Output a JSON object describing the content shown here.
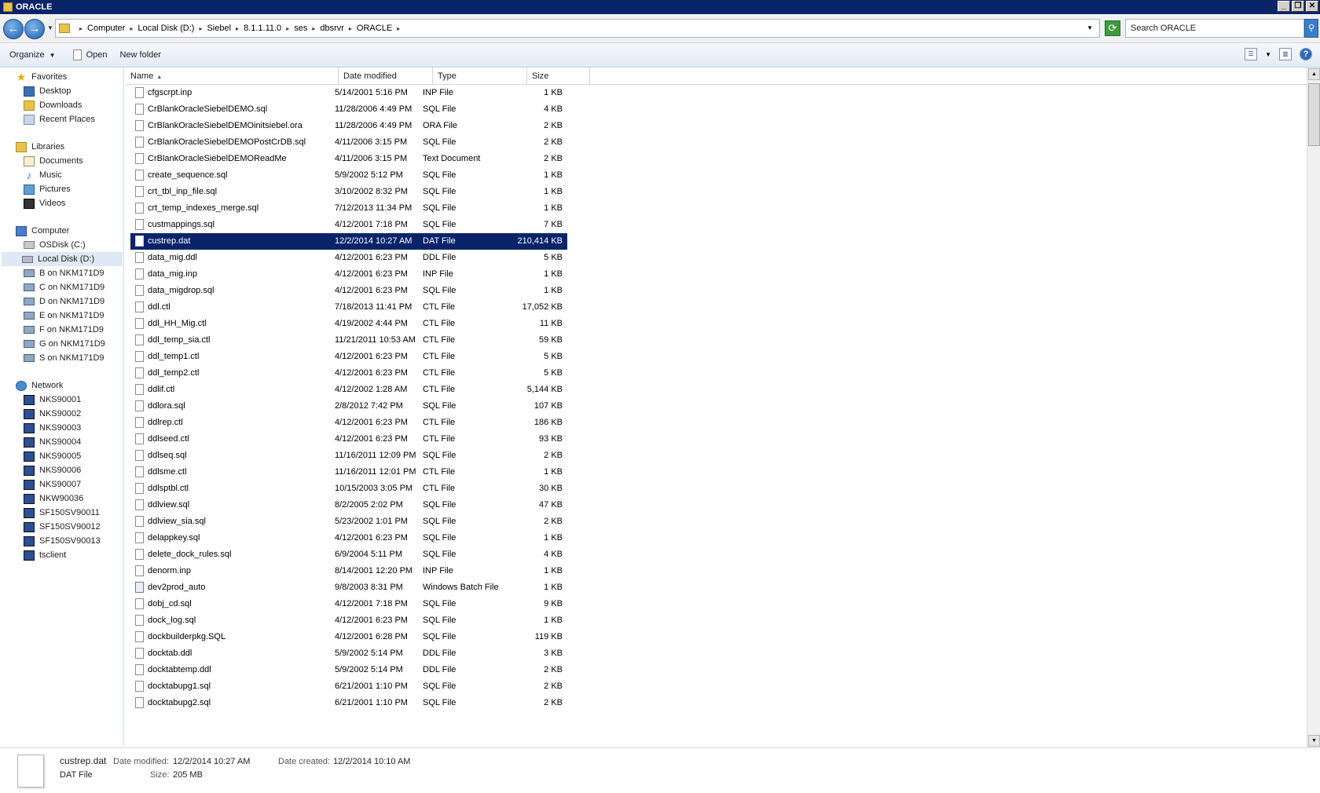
{
  "window": {
    "title": "ORACLE"
  },
  "breadcrumb": [
    "Computer",
    "Local Disk (D:)",
    "Siebel",
    "8.1.1.11.0",
    "ses",
    "dbsrvr",
    "ORACLE"
  ],
  "search": {
    "placeholder": "Search ORACLE"
  },
  "toolbar": {
    "organize": "Organize",
    "open": "Open",
    "new_folder": "New folder"
  },
  "nav": {
    "favorites": {
      "label": "Favorites",
      "items": [
        "Desktop",
        "Downloads",
        "Recent Places"
      ]
    },
    "libraries": {
      "label": "Libraries",
      "items": [
        "Documents",
        "Music",
        "Pictures",
        "Videos"
      ]
    },
    "computer": {
      "label": "Computer",
      "items": [
        "OSDisk (C:)",
        "Local Disk (D:)",
        "B on NKM171D9",
        "C on NKM171D9",
        "D on NKM171D9",
        "E on NKM171D9",
        "F on NKM171D9",
        "G on NKM171D9",
        "S on NKM171D9"
      ],
      "selected": "Local Disk (D:)"
    },
    "network": {
      "label": "Network",
      "items": [
        "NKS90001",
        "NKS90002",
        "NKS90003",
        "NKS90004",
        "NKS90005",
        "NKS90006",
        "NKS90007",
        "NKW90036",
        "SF150SV90011",
        "SF150SV90012",
        "SF150SV90013",
        "tsclient"
      ]
    }
  },
  "columns": {
    "name": "Name",
    "date": "Date modified",
    "type": "Type",
    "size": "Size"
  },
  "files": [
    {
      "name": "cfgscrpt.inp",
      "date": "5/14/2001 5:16 PM",
      "type": "INP File",
      "size": "1 KB"
    },
    {
      "name": "CrBlankOracleSiebelDEMO.sql",
      "date": "11/28/2006 4:49 PM",
      "type": "SQL File",
      "size": "4 KB"
    },
    {
      "name": "CrBlankOracleSiebelDEMOinitsiebel.ora",
      "date": "11/28/2006 4:49 PM",
      "type": "ORA File",
      "size": "2 KB"
    },
    {
      "name": "CrBlankOracleSiebelDEMOPostCrDB.sql",
      "date": "4/11/2006 3:15 PM",
      "type": "SQL File",
      "size": "2 KB"
    },
    {
      "name": "CrBlankOracleSiebelDEMOReadMe",
      "date": "4/11/2006 3:15 PM",
      "type": "Text Document",
      "size": "2 KB"
    },
    {
      "name": "create_sequence.sql",
      "date": "5/9/2002 5:12 PM",
      "type": "SQL File",
      "size": "1 KB"
    },
    {
      "name": "crt_tbl_inp_file.sql",
      "date": "3/10/2002 8:32 PM",
      "type": "SQL File",
      "size": "1 KB"
    },
    {
      "name": "crt_temp_indexes_merge.sql",
      "date": "7/12/2013 11:34 PM",
      "type": "SQL File",
      "size": "1 KB"
    },
    {
      "name": "custmappings.sql",
      "date": "4/12/2001 7:18 PM",
      "type": "SQL File",
      "size": "7 KB"
    },
    {
      "name": "custrep.dat",
      "date": "12/2/2014 10:27 AM",
      "type": "DAT File",
      "size": "210,414 KB",
      "selected": true
    },
    {
      "name": "data_mig.ddl",
      "date": "4/12/2001 6:23 PM",
      "type": "DDL File",
      "size": "5 KB"
    },
    {
      "name": "data_mig.inp",
      "date": "4/12/2001 6:23 PM",
      "type": "INP File",
      "size": "1 KB"
    },
    {
      "name": "data_migdrop.sql",
      "date": "4/12/2001 6:23 PM",
      "type": "SQL File",
      "size": "1 KB"
    },
    {
      "name": "ddl.ctl",
      "date": "7/18/2013 11:41 PM",
      "type": "CTL File",
      "size": "17,052 KB"
    },
    {
      "name": "ddl_HH_Mig.ctl",
      "date": "4/19/2002 4:44 PM",
      "type": "CTL File",
      "size": "11 KB"
    },
    {
      "name": "ddl_temp_sia.ctl",
      "date": "11/21/2011 10:53 AM",
      "type": "CTL File",
      "size": "59 KB"
    },
    {
      "name": "ddl_temp1.ctl",
      "date": "4/12/2001 6:23 PM",
      "type": "CTL File",
      "size": "5 KB"
    },
    {
      "name": "ddl_temp2.ctl",
      "date": "4/12/2001 6:23 PM",
      "type": "CTL File",
      "size": "5 KB"
    },
    {
      "name": "ddlif.ctl",
      "date": "4/12/2002 1:28 AM",
      "type": "CTL File",
      "size": "5,144 KB"
    },
    {
      "name": "ddlora.sql",
      "date": "2/8/2012 7:42 PM",
      "type": "SQL File",
      "size": "107 KB"
    },
    {
      "name": "ddlrep.ctl",
      "date": "4/12/2001 6:23 PM",
      "type": "CTL File",
      "size": "186 KB"
    },
    {
      "name": "ddlseed.ctl",
      "date": "4/12/2001 6:23 PM",
      "type": "CTL File",
      "size": "93 KB"
    },
    {
      "name": "ddlseq.sql",
      "date": "11/16/2011 12:09 PM",
      "type": "SQL File",
      "size": "2 KB"
    },
    {
      "name": "ddlsme.ctl",
      "date": "11/16/2011 12:01 PM",
      "type": "CTL File",
      "size": "1 KB"
    },
    {
      "name": "ddlsptbl.ctl",
      "date": "10/15/2003 3:05 PM",
      "type": "CTL File",
      "size": "30 KB"
    },
    {
      "name": "ddlview.sql",
      "date": "8/2/2005 2:02 PM",
      "type": "SQL File",
      "size": "47 KB"
    },
    {
      "name": "ddlview_sia.sql",
      "date": "5/23/2002 1:01 PM",
      "type": "SQL File",
      "size": "2 KB"
    },
    {
      "name": "delappkey.sql",
      "date": "4/12/2001 6:23 PM",
      "type": "SQL File",
      "size": "1 KB"
    },
    {
      "name": "delete_dock_rules.sql",
      "date": "6/9/2004 5:11 PM",
      "type": "SQL File",
      "size": "4 KB"
    },
    {
      "name": "denorm.inp",
      "date": "8/14/2001 12:20 PM",
      "type": "INP File",
      "size": "1 KB"
    },
    {
      "name": "dev2prod_auto",
      "date": "9/8/2003 8:31 PM",
      "type": "Windows Batch File",
      "size": "1 KB",
      "icon": "batch-file-icon"
    },
    {
      "name": "dobj_cd.sql",
      "date": "4/12/2001 7:18 PM",
      "type": "SQL File",
      "size": "9 KB"
    },
    {
      "name": "dock_log.sql",
      "date": "4/12/2001 6:23 PM",
      "type": "SQL File",
      "size": "1 KB"
    },
    {
      "name": "dockbuilderpkg.SQL",
      "date": "4/12/2001 6:28 PM",
      "type": "SQL File",
      "size": "119 KB"
    },
    {
      "name": "docktab.ddl",
      "date": "5/9/2002 5:14 PM",
      "type": "DDL File",
      "size": "3 KB"
    },
    {
      "name": "docktabtemp.ddl",
      "date": "5/9/2002 5:14 PM",
      "type": "DDL File",
      "size": "2 KB"
    },
    {
      "name": "docktabupg1.sql",
      "date": "6/21/2001 1:10 PM",
      "type": "SQL File",
      "size": "2 KB"
    },
    {
      "name": "docktabupg2.sql",
      "date": "6/21/2001 1:10 PM",
      "type": "SQL File",
      "size": "2 KB"
    }
  ],
  "details": {
    "name": "custrep.dat",
    "type": "DAT File",
    "date_modified_label": "Date modified:",
    "date_modified": "12/2/2014 10:27 AM",
    "size_label": "Size:",
    "size": "205 MB",
    "date_created_label": "Date created:",
    "date_created": "12/2/2014 10:10 AM"
  }
}
